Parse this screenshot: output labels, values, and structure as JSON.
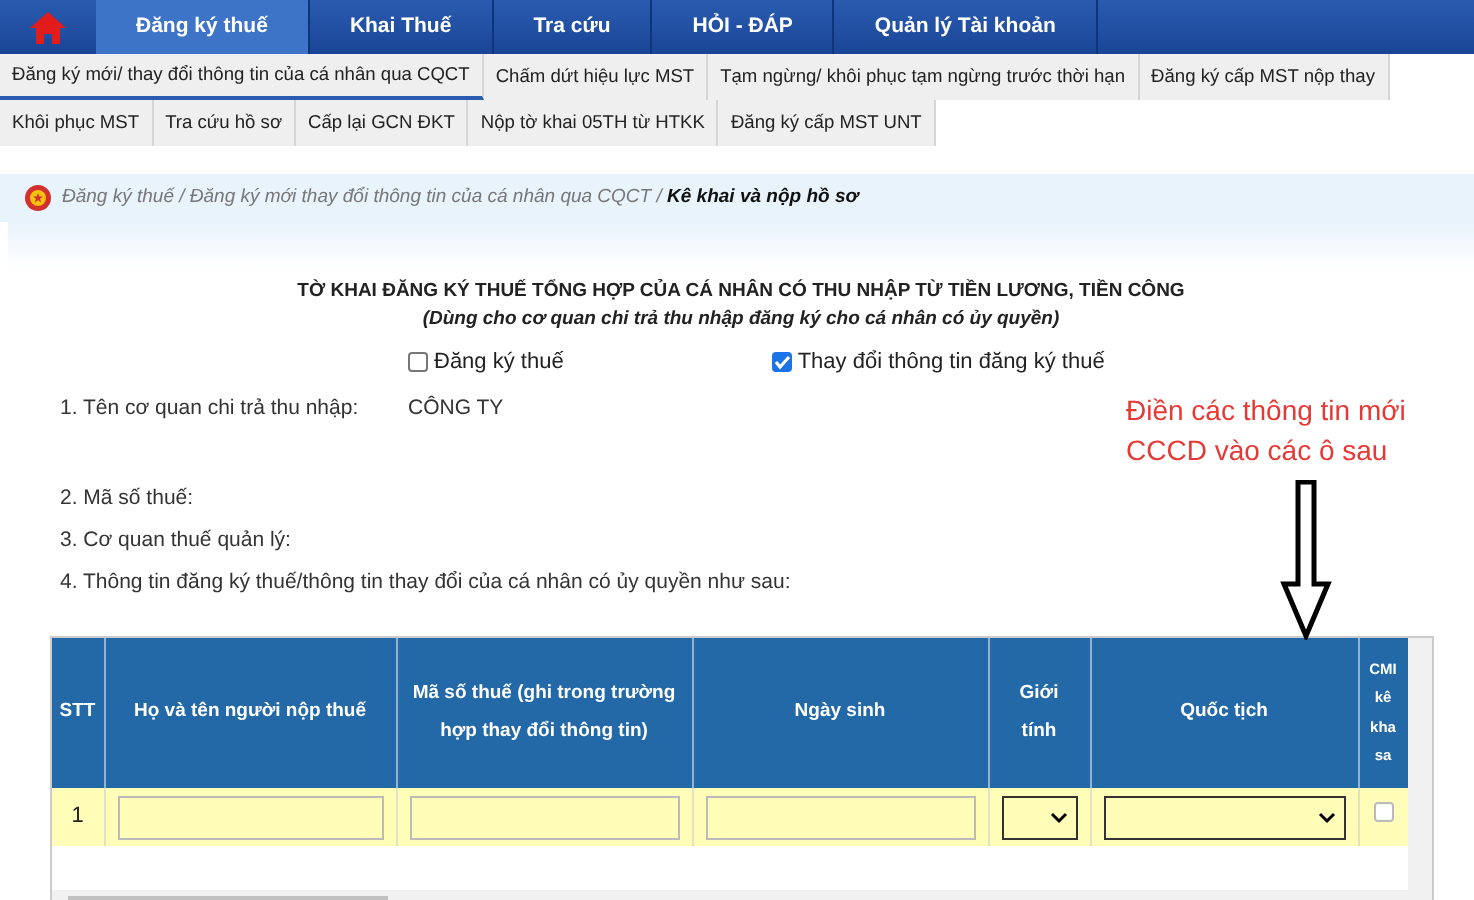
{
  "top_menu": [
    {
      "label": "Đăng ký thuế",
      "selected": true
    },
    {
      "label": "Khai Thuế",
      "selected": false
    },
    {
      "label": "Tra cứu",
      "selected": false
    },
    {
      "label": "HỎI - ĐÁP",
      "selected": false
    },
    {
      "label": "Quản lý Tài khoản",
      "selected": false
    }
  ],
  "sub_menu_rows": [
    [
      {
        "label": "Đăng ký mới/ thay đổi thông tin của cá nhân qua CQCT",
        "selected": true
      },
      {
        "label": "Chấm dứt hiệu lực MST",
        "selected": false
      },
      {
        "label": "Tạm ngừng/ khôi phục tạm ngừng trước thời hạn",
        "selected": false
      },
      {
        "label": "Đăng ký cấp MST nộp thay",
        "selected": false
      }
    ],
    [
      {
        "label": "Khôi phục MST",
        "selected": false
      },
      {
        "label": "Tra cứu hồ sơ",
        "selected": false
      },
      {
        "label": "Cấp lại GCN ĐKT",
        "selected": false
      },
      {
        "label": "Nộp tờ khai 05TH từ HTKK",
        "selected": false
      },
      {
        "label": "Đăng ký cấp MST UNT",
        "selected": false
      }
    ]
  ],
  "breadcrumb": "Đăng ký thuế / Đăng ký mới thay đổi thông tin của cá nhân qua CQCT / **Kê khai và nộp hồ sơ**",
  "form": {
    "title": "TỜ KHAI ĐĂNG KÝ THUẾ TỔNG HỢP CỦA CÁ NHÂN CÓ THU NHẬP TỪ TIỀN LƯƠNG, TIỀN CÔNG",
    "subtitle": "(Dùng cho cơ quan chi trả thu nhập đăng ký cho cá nhân có ủy quyền)",
    "options": [
      {
        "label": "Đăng ký thuế",
        "checked": false
      },
      {
        "label": "Thay đổi thông tin đăng ký thuế",
        "checked": true
      }
    ],
    "fields": [
      {
        "label": "1. Tên cơ quan chi trả thu nhập:",
        "value": "CÔNG TY"
      },
      {
        "label": "2. Mã số thuế:"
      },
      {
        "label": "3. Cơ quan thuế quản lý:"
      }
    ],
    "section_4": "4. Thông tin đăng ký thuế/thông tin thay đổi của cá nhân có ủy quyền như sau:"
  },
  "table": {
    "columns": [
      "STT",
      "Họ và tên người nộp thuế",
      "Mã số thuế (ghi trong trường hợp thay đổi thông tin)",
      "Ngày sinh",
      "Giới tính",
      "Quốc tịch",
      "CMI kê kha sa"
    ],
    "rows": [
      {
        "stt": "1",
        "cells": [
          {
            "kind": "input"
          },
          {
            "kind": "input"
          },
          {
            "kind": "input"
          },
          {
            "kind": "select"
          },
          {
            "kind": "select"
          },
          {
            "kind": "checkbox",
            "checked": false
          }
        ]
      }
    ]
  },
  "annotation": {
    "text": "Điền các thông tin mới CCCD vào các ô sau"
  }
}
